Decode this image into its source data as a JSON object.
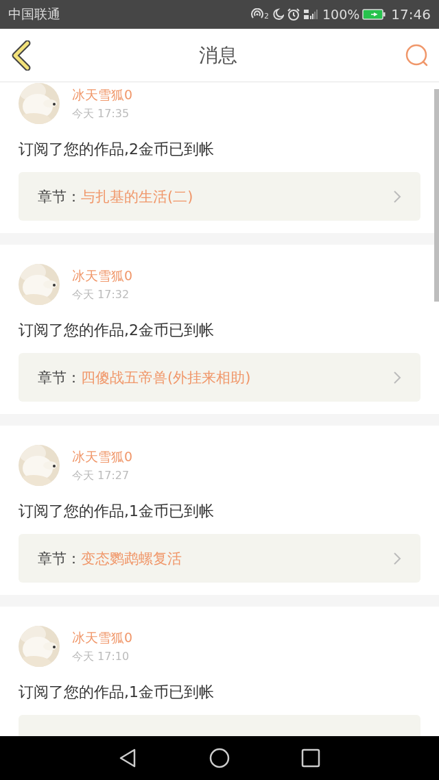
{
  "status_bar": {
    "carrier": "中国联通",
    "hotspot_count": "2",
    "battery": "100%",
    "time": "17:46"
  },
  "header": {
    "title": "消息"
  },
  "messages": [
    {
      "name": "冰天雪狐0",
      "time": "今天 17:35",
      "text": "订阅了您的作品,2金币已到帐",
      "chapter_label": "章节：",
      "chapter": "与扎基的生活(二)"
    },
    {
      "name": "冰天雪狐0",
      "time": "今天 17:32",
      "text": "订阅了您的作品,2金币已到帐",
      "chapter_label": "章节：",
      "chapter": "四傻战五帝兽(外挂来相助)"
    },
    {
      "name": "冰天雪狐0",
      "time": "今天 17:27",
      "text": "订阅了您的作品,1金币已到帐",
      "chapter_label": "章节：",
      "chapter": "变态鹦鹉螺复活"
    },
    {
      "name": "冰天雪狐0",
      "time": "今天 17:10",
      "text": "订阅了您的作品,1金币已到帐"
    }
  ]
}
